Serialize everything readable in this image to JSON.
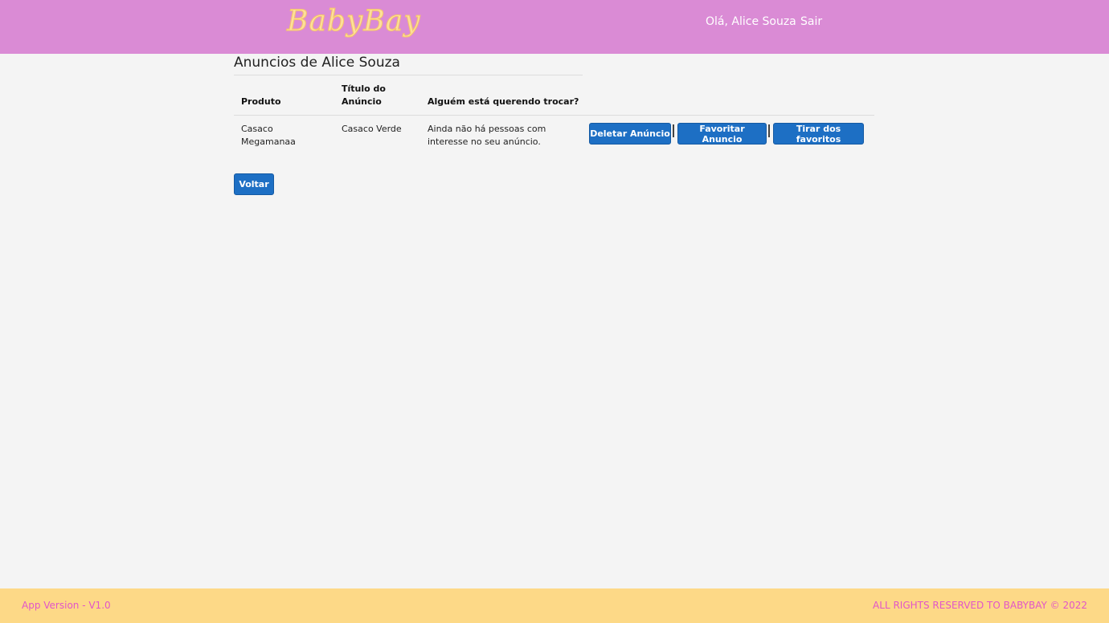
{
  "header": {
    "logo_text": "BabyBay",
    "greeting": "Olá, Alice Souza",
    "logout": "Sair"
  },
  "page": {
    "title": "Anuncios de Alice Souza"
  },
  "table": {
    "columns": [
      "Produto",
      "Título do Anúncio",
      "Alguém está querendo trocar?"
    ],
    "rows": [
      {
        "produto": "Casaco Megamanaa",
        "titulo": "Casaco Verde",
        "trocar": "Ainda não há pessoas com interesse no seu anúncio.",
        "actions": [
          "Deletar Anúncio",
          "Favoritar Anuncio",
          "Tirar dos favoritos"
        ]
      }
    ]
  },
  "back_button": "Voltar",
  "footer": {
    "version": "App Version - V1.0",
    "rights": "ALL RIGHTS RESERVED TO BABYBAY © 2022"
  },
  "colors": {
    "navbar": "#da8bd5",
    "logo": "#fde09a",
    "button": "#1d6fc4",
    "footer": "#fdd987",
    "footer_text": "#e255c8"
  }
}
